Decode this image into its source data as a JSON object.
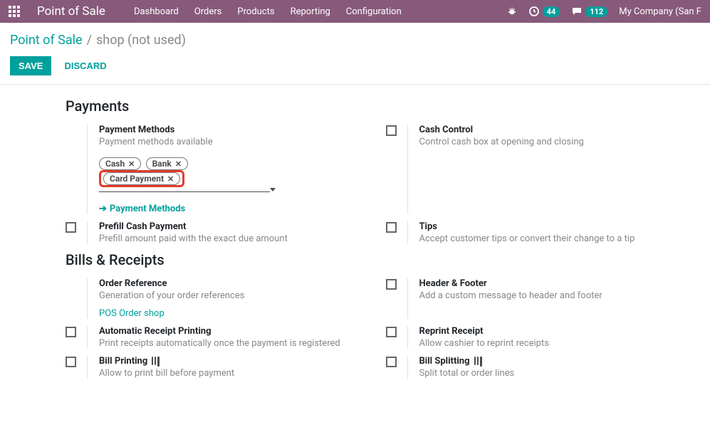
{
  "navbar": {
    "brand": "Point of Sale",
    "menu": [
      "Dashboard",
      "Orders",
      "Products",
      "Reporting",
      "Configuration"
    ],
    "activities_count": "44",
    "messages_count": "112",
    "company": "My Company (San F"
  },
  "breadcrumb": {
    "root": "Point of Sale",
    "sep": "/",
    "current": "shop (not used)"
  },
  "actions": {
    "save": "SAVE",
    "discard": "DISCARD"
  },
  "sections": {
    "payments": "Payments",
    "bills": "Bills & Receipts"
  },
  "payments": {
    "methods_label": "Payment Methods",
    "methods_desc": "Payment methods available",
    "tags": [
      "Cash",
      "Bank",
      "Card Payment"
    ],
    "methods_link": "Payment Methods",
    "cash_control_label": "Cash Control",
    "cash_control_desc": "Control cash box at opening and closing",
    "prefill_label": "Prefill Cash Payment",
    "prefill_desc": "Prefill amount paid with the exact due amount",
    "tips_label": "Tips",
    "tips_desc": "Accept customer tips or convert their change to a tip"
  },
  "bills": {
    "order_ref_label": "Order Reference",
    "order_ref_desc": "Generation of your order references",
    "pos_link": "POS Order shop",
    "header_footer_label": "Header & Footer",
    "header_footer_desc": "Add a custom message to header and footer",
    "auto_receipt_label": "Automatic Receipt Printing",
    "auto_receipt_desc": "Print receipts automatically once the payment is registered",
    "reprint_label": "Reprint Receipt",
    "reprint_desc": "Allow cashier to reprint receipts",
    "bill_print_label": "Bill Printing",
    "bill_print_desc": "Allow to print bill before payment",
    "bill_split_label": "Bill Splitting",
    "bill_split_desc": "Split total or order lines"
  }
}
